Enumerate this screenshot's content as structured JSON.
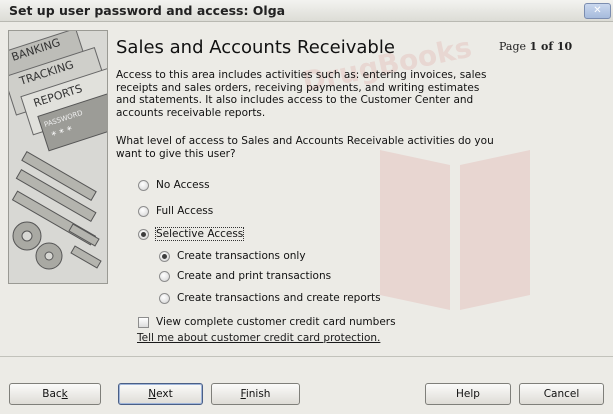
{
  "window": {
    "title": "Set up user password and access: Olga",
    "close_glyph": "✕"
  },
  "watermark": {
    "text": "DrugBooks"
  },
  "illustration": {
    "labels": [
      "BANKING",
      "TRACKING",
      "REPORTS",
      "PASSWORD",
      "* * *"
    ]
  },
  "section": {
    "heading": "Sales and Accounts Receivable",
    "page_prefix": "Page ",
    "page_value": "1 of 10",
    "description": "Access to this area includes activities such as: entering invoices, sales receipts and sales orders, receiving payments, and writing estimates and statements. It also includes access to the Customer Center and accounts receivable reports.",
    "question": "What level of access to Sales and Accounts Receivable activities do you want to give this user?"
  },
  "access_options": [
    {
      "label": "No Access",
      "checked": false
    },
    {
      "label": "Full Access",
      "checked": false
    },
    {
      "label": "Selective Access",
      "checked": true
    }
  ],
  "selective_options": [
    {
      "label": "Create transactions only",
      "checked": true
    },
    {
      "label": "Create and print transactions",
      "checked": false
    },
    {
      "label": "Create transactions and create reports",
      "checked": false
    }
  ],
  "credit_card": {
    "checkbox_label": "View complete customer credit card numbers",
    "checked": false,
    "link_text": "Tell me about customer credit card protection."
  },
  "buttons": {
    "back": {
      "pre": "Bac",
      "mnemonic": "k",
      "post": ""
    },
    "next": {
      "pre": "",
      "mnemonic": "N",
      "post": "ext"
    },
    "finish": {
      "pre": "",
      "mnemonic": "F",
      "post": "inish"
    },
    "help": {
      "label": "Help"
    },
    "cancel": {
      "label": "Cancel"
    }
  },
  "colors": {
    "background": "#ecebe6",
    "title_bar": "#dcdcd6",
    "watermark": "#c82828"
  }
}
